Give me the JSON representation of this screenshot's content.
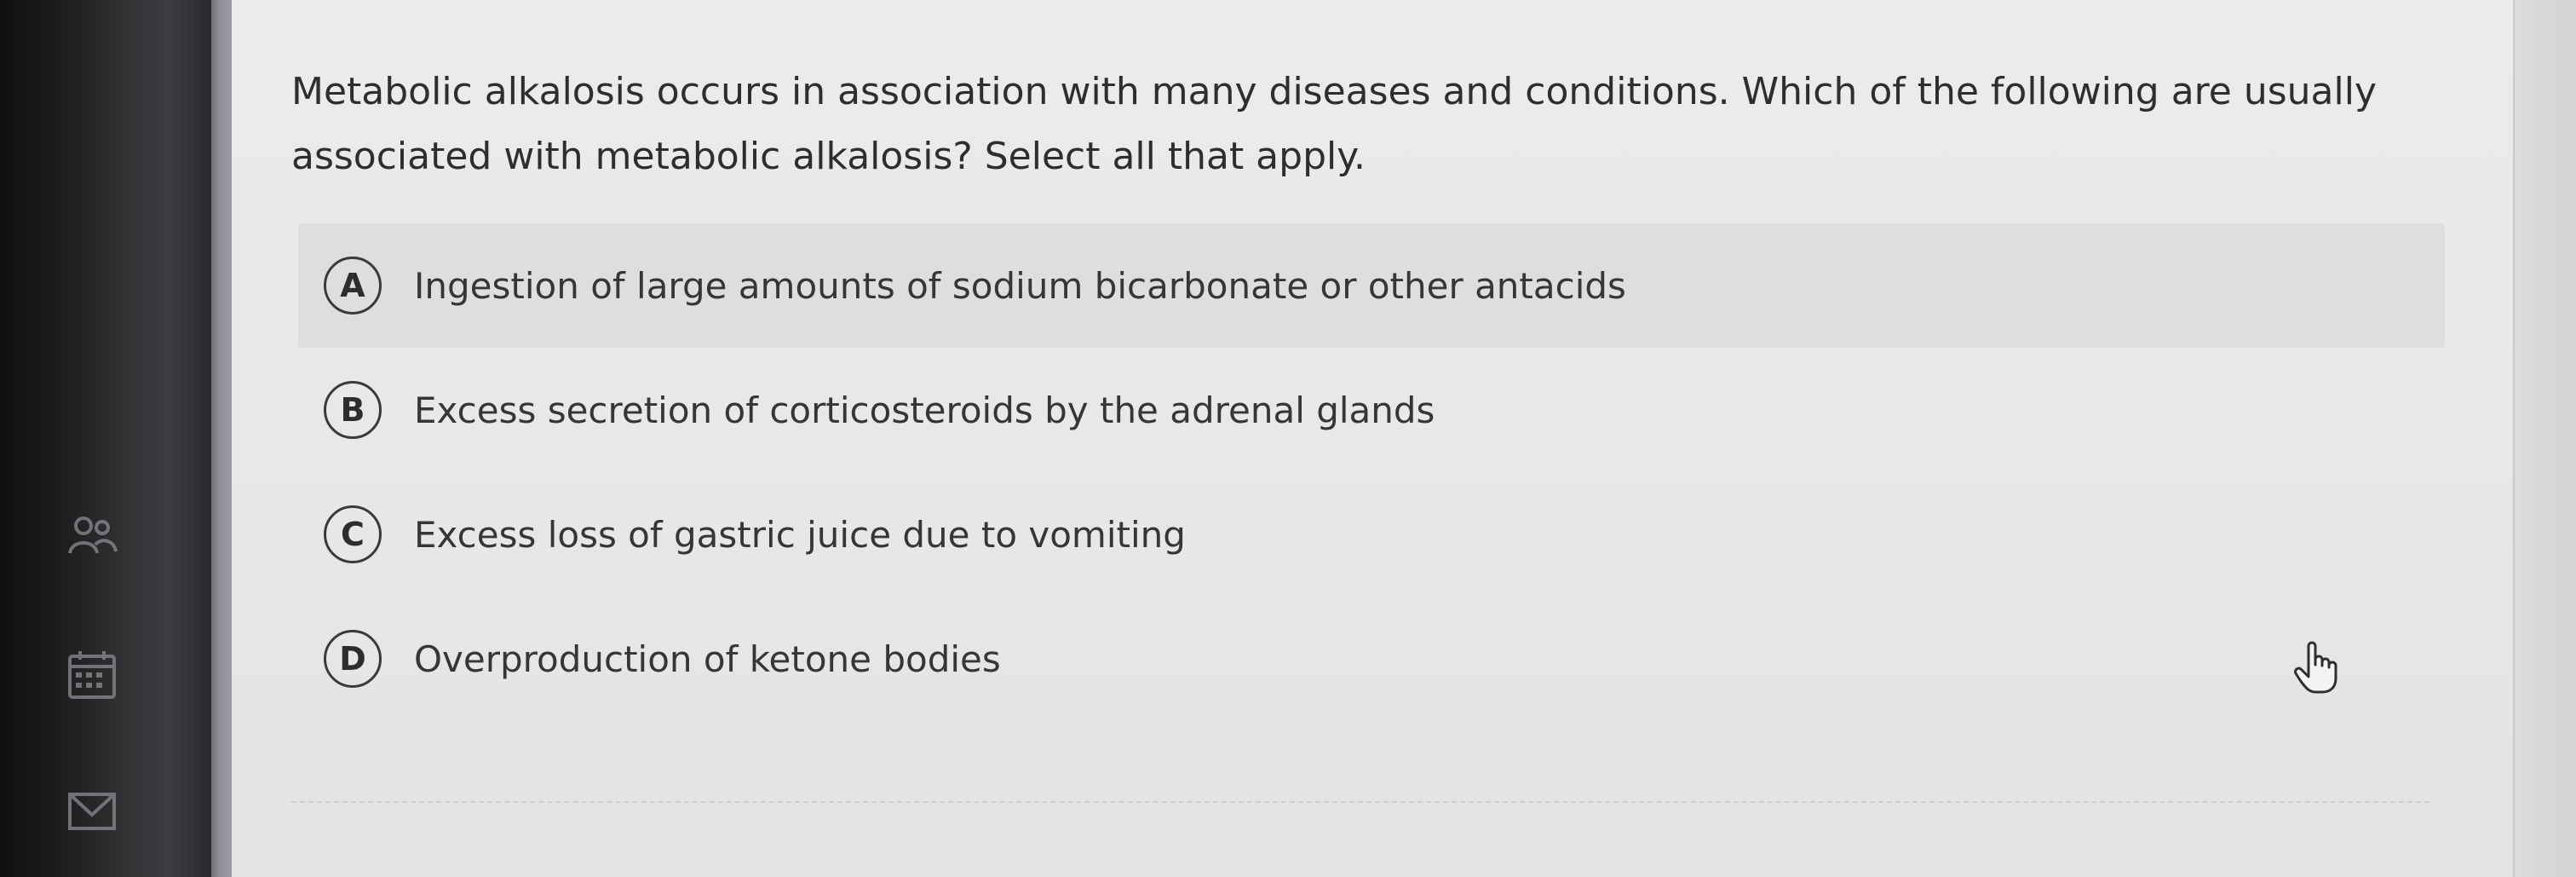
{
  "question": {
    "text": "Metabolic alkalosis occurs in association with many diseases and conditions. Which of the following are usually associated with metabolic alkalosis? Select all that apply."
  },
  "options": [
    {
      "letter": "A",
      "text": "Ingestion of large amounts of sodium bicarbonate or other antacids"
    },
    {
      "letter": "B",
      "text": "Excess secretion of corticosteroids by the adrenal glands"
    },
    {
      "letter": "C",
      "text": "Excess loss of gastric juice due to vomiting"
    },
    {
      "letter": "D",
      "text": "Overproduction of ketone bodies"
    }
  ],
  "sidebar": {
    "icons": [
      "people-icon",
      "calendar-icon",
      "mail-icon"
    ]
  },
  "colors": {
    "page_background": "#e8e8e6",
    "hover_row": "#dededc",
    "text": "#333333",
    "sidebar": "#2a2a2d"
  }
}
